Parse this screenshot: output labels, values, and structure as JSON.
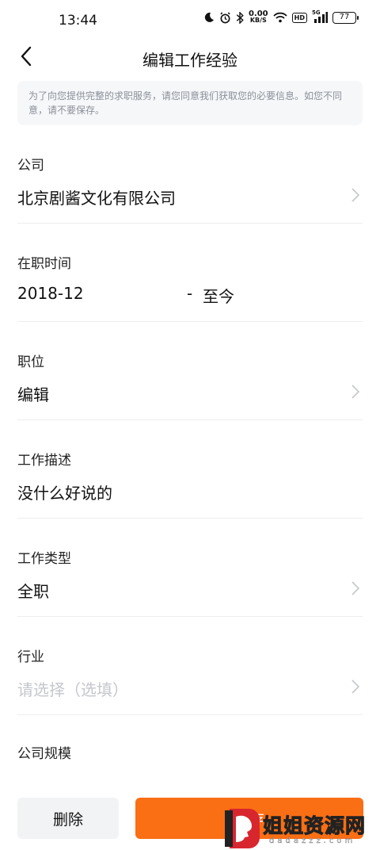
{
  "status_bar": {
    "time": "13:44",
    "net_speed_value": "0.00",
    "net_speed_unit": "KB/S",
    "hd_label": "HD",
    "signal_label": "5G",
    "battery_level": "77"
  },
  "nav": {
    "back_icon": "chevron-left-icon",
    "title": "编辑工作经验"
  },
  "notice": {
    "text": "为了向您提供完整的求职服务，请您同意我们获取您的必要信息。如您不同意，请不要保存。"
  },
  "form": {
    "company": {
      "label": "公司",
      "value": "北京剧酱文化有限公司"
    },
    "tenure": {
      "label": "在职时间",
      "start": "2018-12",
      "separator": "-",
      "end": "至今"
    },
    "position": {
      "label": "职位",
      "value": "编辑"
    },
    "description": {
      "label": "工作描述",
      "value": "没什么好说的"
    },
    "job_type": {
      "label": "工作类型",
      "value": "全职"
    },
    "industry": {
      "label": "行业",
      "placeholder": "请选择（选填）"
    },
    "company_size": {
      "label": "公司规模"
    }
  },
  "buttons": {
    "delete": "删除",
    "save": "保存"
  },
  "colors": {
    "accent": "#fa6e14",
    "notice_bg": "#f6f7f9",
    "placeholder": "#c4c7cc"
  },
  "watermark": {
    "text": "姐姐资源网",
    "sub": "dadazzz.com"
  }
}
